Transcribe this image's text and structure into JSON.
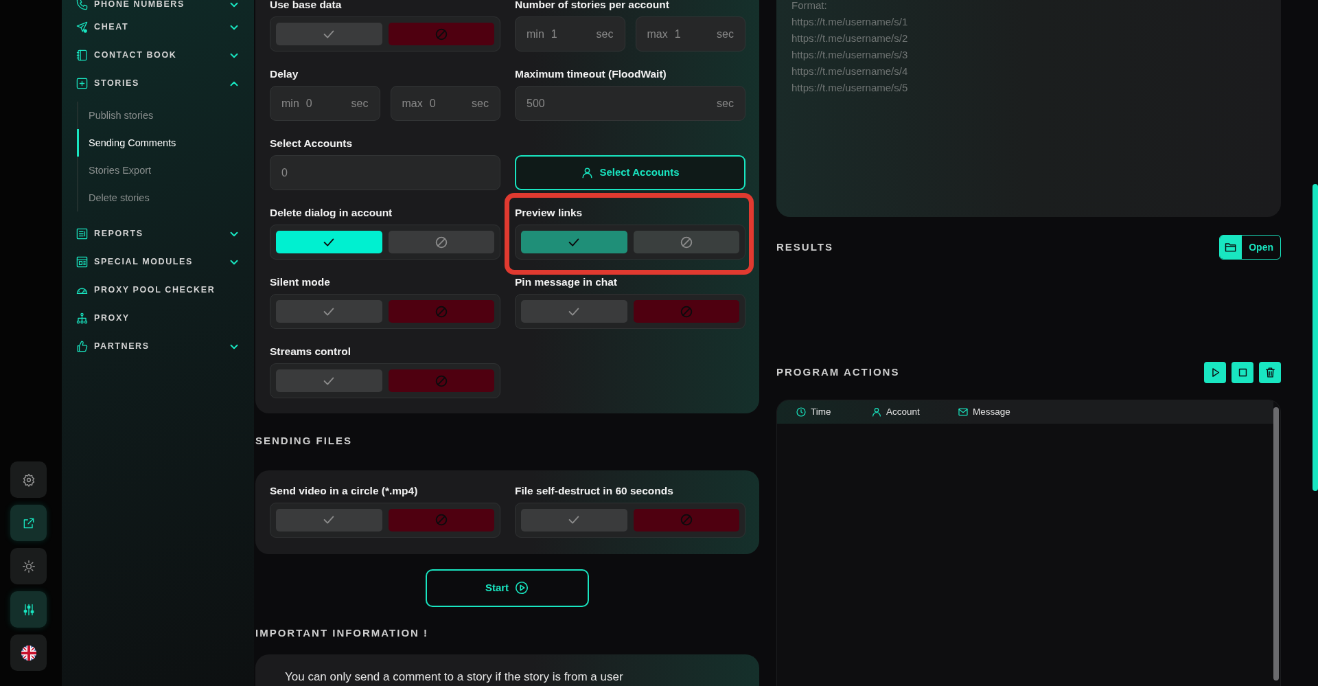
{
  "rail": [
    {
      "kind": "gear",
      "active": false
    },
    {
      "kind": "external",
      "active": true
    },
    {
      "kind": "sun",
      "active": false
    },
    {
      "kind": "sliders",
      "active": true
    },
    {
      "kind": "flag",
      "active": false
    }
  ],
  "sidebar": {
    "items": [
      {
        "label": "PHONE NUMBERS",
        "kind": "phone",
        "expanded": false
      },
      {
        "label": "CHEAT",
        "kind": "plane",
        "expanded": false
      },
      {
        "label": "CONTACT BOOK",
        "kind": "book",
        "expanded": false
      },
      {
        "label": "STORIES",
        "kind": "plus",
        "expanded": true,
        "children": [
          {
            "label": "Publish stories",
            "selected": false
          },
          {
            "label": "Sending Comments",
            "selected": true
          },
          {
            "label": "Stories Export",
            "selected": false
          },
          {
            "label": "Delete stories",
            "selected": false
          }
        ]
      },
      {
        "label": "REPORTS",
        "kind": "report",
        "expanded": false
      },
      {
        "label": "SPECIAL MODULES",
        "kind": "modules",
        "expanded": false
      },
      {
        "label": "PROXY POOL CHECKER",
        "kind": "gauge"
      },
      {
        "label": "PROXY",
        "kind": "network"
      },
      {
        "label": "PARTNERS",
        "kind": "thumb",
        "expanded": false
      }
    ]
  },
  "form": {
    "cells": [
      {
        "kind": "toggle",
        "label": "Use base data",
        "on": false
      },
      {
        "kind": "range",
        "label": "Number of stories per account",
        "inputs": [
          {
            "prefix": "min",
            "value": "1",
            "suffix": "sec"
          },
          {
            "prefix": "max",
            "value": "1",
            "suffix": "sec"
          }
        ]
      },
      {
        "kind": "range",
        "label": "Delay",
        "inputs": [
          {
            "prefix": "min",
            "value": "0",
            "suffix": "sec"
          },
          {
            "prefix": "max",
            "value": "0",
            "suffix": "sec"
          }
        ]
      },
      {
        "kind": "number",
        "label": "Maximum timeout (FloodWait)",
        "value": "500",
        "suffix": "sec"
      },
      {
        "kind": "input",
        "label": "Select Accounts",
        "value": "0"
      },
      {
        "kind": "button",
        "text": "Select Accounts"
      },
      {
        "kind": "toggle",
        "label": "Delete dialog in account",
        "on": true
      },
      {
        "kind": "toggle",
        "label": "Preview links",
        "on": true,
        "muted": true,
        "highlighted": true
      },
      {
        "kind": "toggle",
        "label": "Silent mode",
        "on": false
      },
      {
        "kind": "toggle",
        "label": "Pin message in chat",
        "on": false
      },
      {
        "kind": "toggle",
        "label": "Streams control",
        "on": false
      }
    ]
  },
  "sending_files": {
    "title": "SENDING FILES",
    "cells": [
      {
        "kind": "toggle",
        "label": "Send video in a circle (*.mp4)",
        "on": false
      },
      {
        "kind": "toggle",
        "label": "File self-destruct in 60 seconds",
        "on": false
      }
    ]
  },
  "start_button": "Start",
  "important": {
    "title": "IMPORTANT INFORMATION !",
    "text": "You can only send a comment to a story if the story is from a user"
  },
  "links_field": {
    "placeholder": "Format:\nhttps://t.me/username/s/1\nhttps://t.me/username/s/2\nhttps://t.me/username/s/3\nhttps://t.me/username/s/4\nhttps://t.me/username/s/5"
  },
  "results": {
    "title": "RESULTS",
    "open_button": "Open"
  },
  "program_actions": {
    "title": "PROGRAM ACTIONS",
    "buttons": [
      {
        "kind": "play"
      },
      {
        "kind": "stop"
      },
      {
        "kind": "trash"
      }
    ],
    "columns": [
      {
        "label": "Time",
        "kind": "clock"
      },
      {
        "label": "Account",
        "kind": "user"
      },
      {
        "label": "Message",
        "kind": "mail"
      }
    ]
  }
}
